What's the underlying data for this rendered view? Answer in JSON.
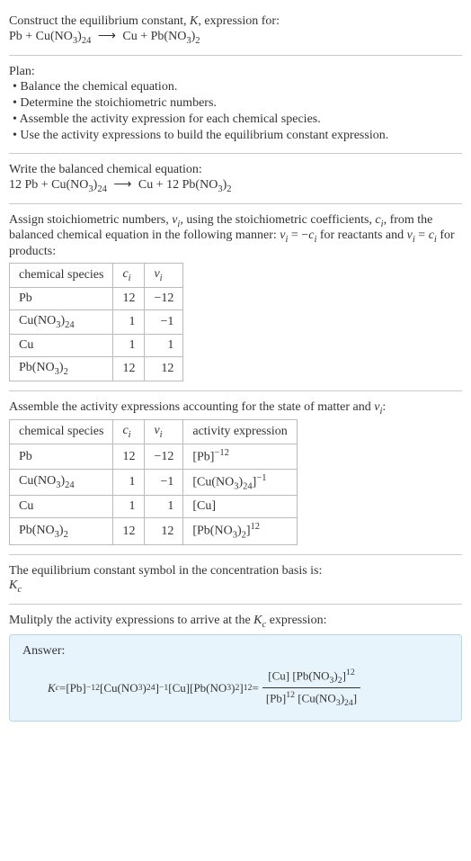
{
  "header": {
    "title_line1": "Construct the equilibrium constant, ",
    "title_K": "K",
    "title_line1_end": ", expression for:",
    "eq_lhs_Pb": "Pb + Cu(NO",
    "eq_lhs_sub1": "3",
    "eq_lhs_close": ")",
    "eq_lhs_sub2": "24",
    "eq_arrow": "⟶",
    "eq_rhs": "Cu + Pb(NO",
    "eq_rhs_sub1": "3",
    "eq_rhs_close": ")",
    "eq_rhs_sub2": "2"
  },
  "plan": {
    "heading": "Plan:",
    "items": [
      "• Balance the chemical equation.",
      "• Determine the stoichiometric numbers.",
      "• Assemble the activity expression for each chemical species.",
      "• Use the activity expressions to build the equilibrium constant expression."
    ]
  },
  "balanced": {
    "heading": "Write the balanced chemical equation:",
    "lhs_12": "12 Pb + Cu(NO",
    "sub1": "3",
    "close1": ")",
    "sub2": "24",
    "arrow": "⟶",
    "rhs": "Cu + 12 Pb(NO",
    "sub3": "3",
    "close2": ")",
    "sub4": "2"
  },
  "stoich": {
    "text1": "Assign stoichiometric numbers, ",
    "nu_i": "ν",
    "sub_i": "i",
    "text2": ", using the stoichiometric coefficients, ",
    "c_i": "c",
    "text3": ", from the balanced chemical equation in the following manner: ",
    "nu": "ν",
    "eq1": " = −",
    "c": "c",
    "text4": " for reactants and ",
    "eq2": " = ",
    "text5": " for products:",
    "table": {
      "h1": "chemical species",
      "h2_c": "c",
      "h2_i": "i",
      "h3_v": "ν",
      "h3_i": "i",
      "rows": [
        {
          "sp": "Pb",
          "c": "12",
          "v": "−12"
        },
        {
          "sp_pre": "Cu(NO",
          "sp_s1": "3",
          "sp_mid": ")",
          "sp_s2": "24",
          "c": "1",
          "v": "−1"
        },
        {
          "sp": "Cu",
          "c": "1",
          "v": "1"
        },
        {
          "sp_pre": "Pb(NO",
          "sp_s1": "3",
          "sp_mid": ")",
          "sp_s2": "2",
          "c": "12",
          "v": "12"
        }
      ]
    }
  },
  "activity": {
    "text1": "Assemble the activity expressions accounting for the state of matter and ",
    "nu": "ν",
    "sub_i": "i",
    "colon": ":",
    "table": {
      "h1": "chemical species",
      "h2_c": "c",
      "h2_i": "i",
      "h3_v": "ν",
      "h3_i": "i",
      "h4": "activity expression",
      "rows": [
        {
          "sp": "Pb",
          "c": "12",
          "v": "−12",
          "ae_pre": "[Pb]",
          "ae_sup": "−12"
        },
        {
          "sp_pre": "Cu(NO",
          "sp_s1": "3",
          "sp_mid": ")",
          "sp_s2": "24",
          "c": "1",
          "v": "−1",
          "ae_pre": "[Cu(NO",
          "ae_s1": "3",
          "ae_mid": ")",
          "ae_s2": "24",
          "ae_close": "]",
          "ae_sup": "−1"
        },
        {
          "sp": "Cu",
          "c": "1",
          "v": "1",
          "ae_pre": "[Cu]"
        },
        {
          "sp_pre": "Pb(NO",
          "sp_s1": "3",
          "sp_mid": ")",
          "sp_s2": "2",
          "c": "12",
          "v": "12",
          "ae_pre": "[Pb(NO",
          "ae_s1": "3",
          "ae_mid": ")",
          "ae_s2": "2",
          "ae_close": "]",
          "ae_sup": "12"
        }
      ]
    }
  },
  "kc_symbol": {
    "text": "The equilibrium constant symbol in the concentration basis is:",
    "K": "K",
    "c": "c"
  },
  "multiply": {
    "text1": "Mulitply the activity expressions to arrive at the ",
    "K": "K",
    "c": "c",
    "text2": " expression:"
  },
  "answer": {
    "label": "Answer:",
    "Kc_K": "K",
    "Kc_c": "c",
    "eq": " = ",
    "t1": "[Pb]",
    "t1_sup": "−12",
    "sp": " ",
    "t2_a": "[Cu(NO",
    "t2_s1": "3",
    "t2_b": ")",
    "t2_s2": "24",
    "t2_c": "]",
    "t2_sup": "−1",
    "t3": "[Cu]",
    "t4_a": "[Pb(NO",
    "t4_s1": "3",
    "t4_b": ")",
    "t4_s2": "2",
    "t4_c": "]",
    "t4_sup": "12",
    "eq2": " = ",
    "frac_num_a": "[Cu] [Pb(NO",
    "frac_num_s1": "3",
    "frac_num_b": ")",
    "frac_num_s2": "2",
    "frac_num_c": "]",
    "frac_num_sup": "12",
    "frac_den_a": "[Pb]",
    "frac_den_sup1": "12",
    "frac_den_sp": " ",
    "frac_den_b": "[Cu(NO",
    "frac_den_s1": "3",
    "frac_den_c": ")",
    "frac_den_s2": "24",
    "frac_den_d": "]"
  }
}
